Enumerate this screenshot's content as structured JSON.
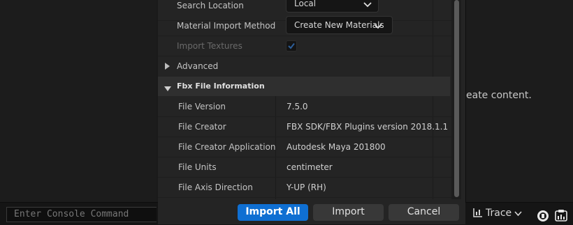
{
  "background": {
    "right_panel_text": "eate content."
  },
  "console": {
    "placeholder": "Enter Console Command",
    "trace_label": "Trace"
  },
  "import_options": {
    "rows": [
      {
        "label": "Search Location",
        "value": "Local"
      },
      {
        "label": "Material Import Method",
        "value": "Create New Materials"
      },
      {
        "label": "Import Textures",
        "checked": true
      }
    ],
    "advanced_label": "Advanced"
  },
  "fbx_info": {
    "section_title": "Fbx File Information",
    "rows": [
      {
        "label": "File Version",
        "value": "7.5.0"
      },
      {
        "label": "File Creator",
        "value": "FBX SDK/FBX Plugins version 2018.1.1"
      },
      {
        "label": "File Creator Application",
        "value": "Autodesk Maya 201800"
      },
      {
        "label": "File Units",
        "value": "centimeter"
      },
      {
        "label": "File Axis Direction",
        "value": "Y-UP (RH)"
      }
    ]
  },
  "buttons": {
    "import_all": "Import All",
    "import": "Import",
    "cancel": "Cancel"
  },
  "colors": {
    "accent": "#0f6fd2",
    "checkmark": "#2d5f9a",
    "panel": "#242424"
  }
}
